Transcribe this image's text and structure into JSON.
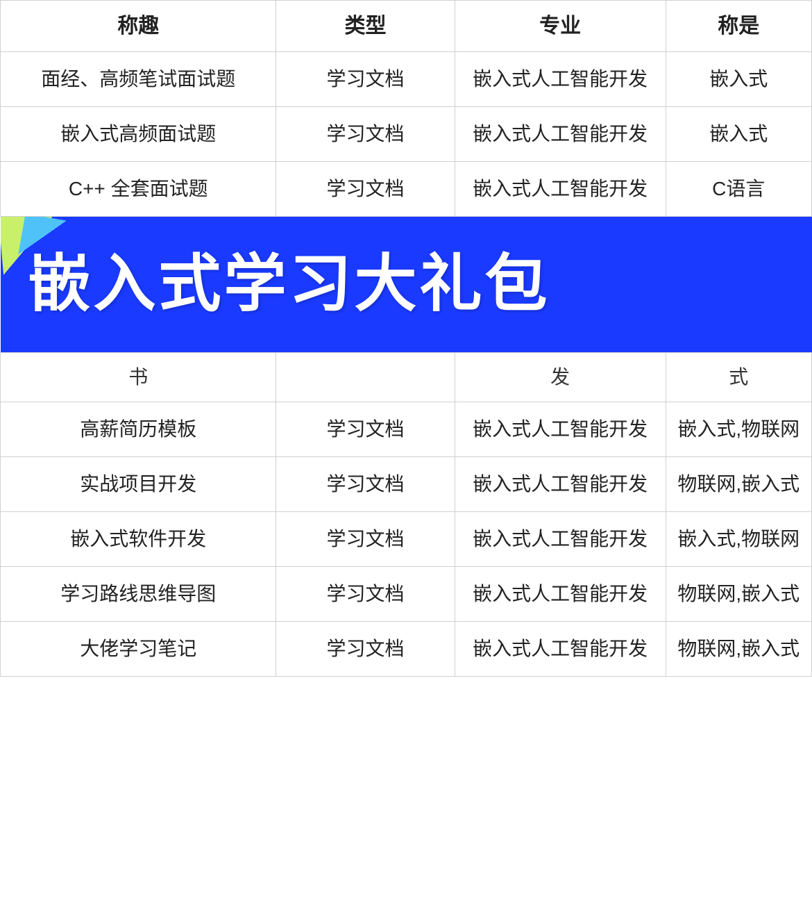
{
  "headers": [
    "称趣",
    "类型",
    "专业",
    "称是"
  ],
  "rows": [
    {
      "col1": "面经、高频笔试面试题",
      "col2": "学习文档",
      "col3": "嵌入式人工智能开发",
      "col4": "嵌入式"
    },
    {
      "col1": "嵌入式高频面试题",
      "col2": "学习文档",
      "col3": "嵌入式人工智能开发",
      "col4": "嵌入式"
    },
    {
      "col1": "C++ 全套面试题",
      "col2": "学习文档",
      "col3": "嵌入式人工智能开发",
      "col4": "C语言"
    }
  ],
  "banner": {
    "text": "嵌入式学习大礼包"
  },
  "partial_row": {
    "col1": "书",
    "col2": "",
    "col3": "发",
    "col4": "式"
  },
  "rows2": [
    {
      "col1": "高薪简历模板",
      "col2": "学习文档",
      "col3": "嵌入式人工智能开发",
      "col4": "嵌入式,物联网"
    },
    {
      "col1": "实战项目开发",
      "col2": "学习文档",
      "col3": "嵌入式人工智能开发",
      "col4": "物联网,嵌入式"
    },
    {
      "col1": "嵌入式软件开发",
      "col2": "学习文档",
      "col3": "嵌入式人工智能开发",
      "col4": "嵌入式,物联网"
    },
    {
      "col1": "学习路线思维导图",
      "col2": "学习文档",
      "col3": "嵌入式人工智能开发",
      "col4": "物联网,嵌入式"
    },
    {
      "col1": "大佬学习笔记",
      "col2": "学习文档",
      "col3": "嵌入式人工智能开发",
      "col4": "物联网,嵌入式"
    }
  ]
}
